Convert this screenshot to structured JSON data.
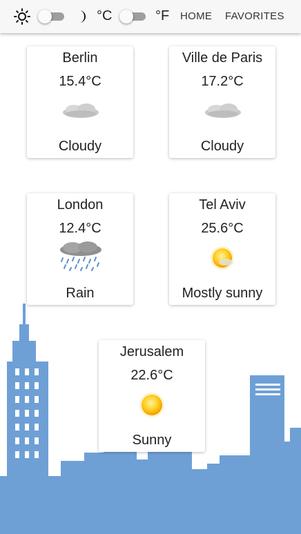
{
  "header": {
    "units": {
      "celsius": "°C",
      "fahrenheit": "°F"
    },
    "nav": {
      "home": "HOME",
      "favorites": "FAVORITES"
    },
    "icons": {
      "theme_light": "sun-icon",
      "theme_dark": "moon-icon"
    }
  },
  "cities": [
    {
      "name": "Berlin",
      "temp": "15.4°C",
      "condition": "Cloudy",
      "icon": "cloud-icon"
    },
    {
      "name": "Ville de Paris",
      "temp": "17.2°C",
      "condition": "Cloudy",
      "icon": "cloud-icon"
    },
    {
      "name": "London",
      "temp": "12.4°C",
      "condition": "Rain",
      "icon": "rain-icon"
    },
    {
      "name": "Tel Aviv",
      "temp": "25.6°C",
      "condition": "Mostly sunny",
      "icon": "partly-sunny-icon"
    },
    {
      "name": "Jerusalem",
      "temp": "22.6°C",
      "condition": "Sunny",
      "icon": "sun-icon"
    }
  ],
  "colors": {
    "skyline": "#6ea0d6",
    "appbar": "#f7f7f7"
  }
}
